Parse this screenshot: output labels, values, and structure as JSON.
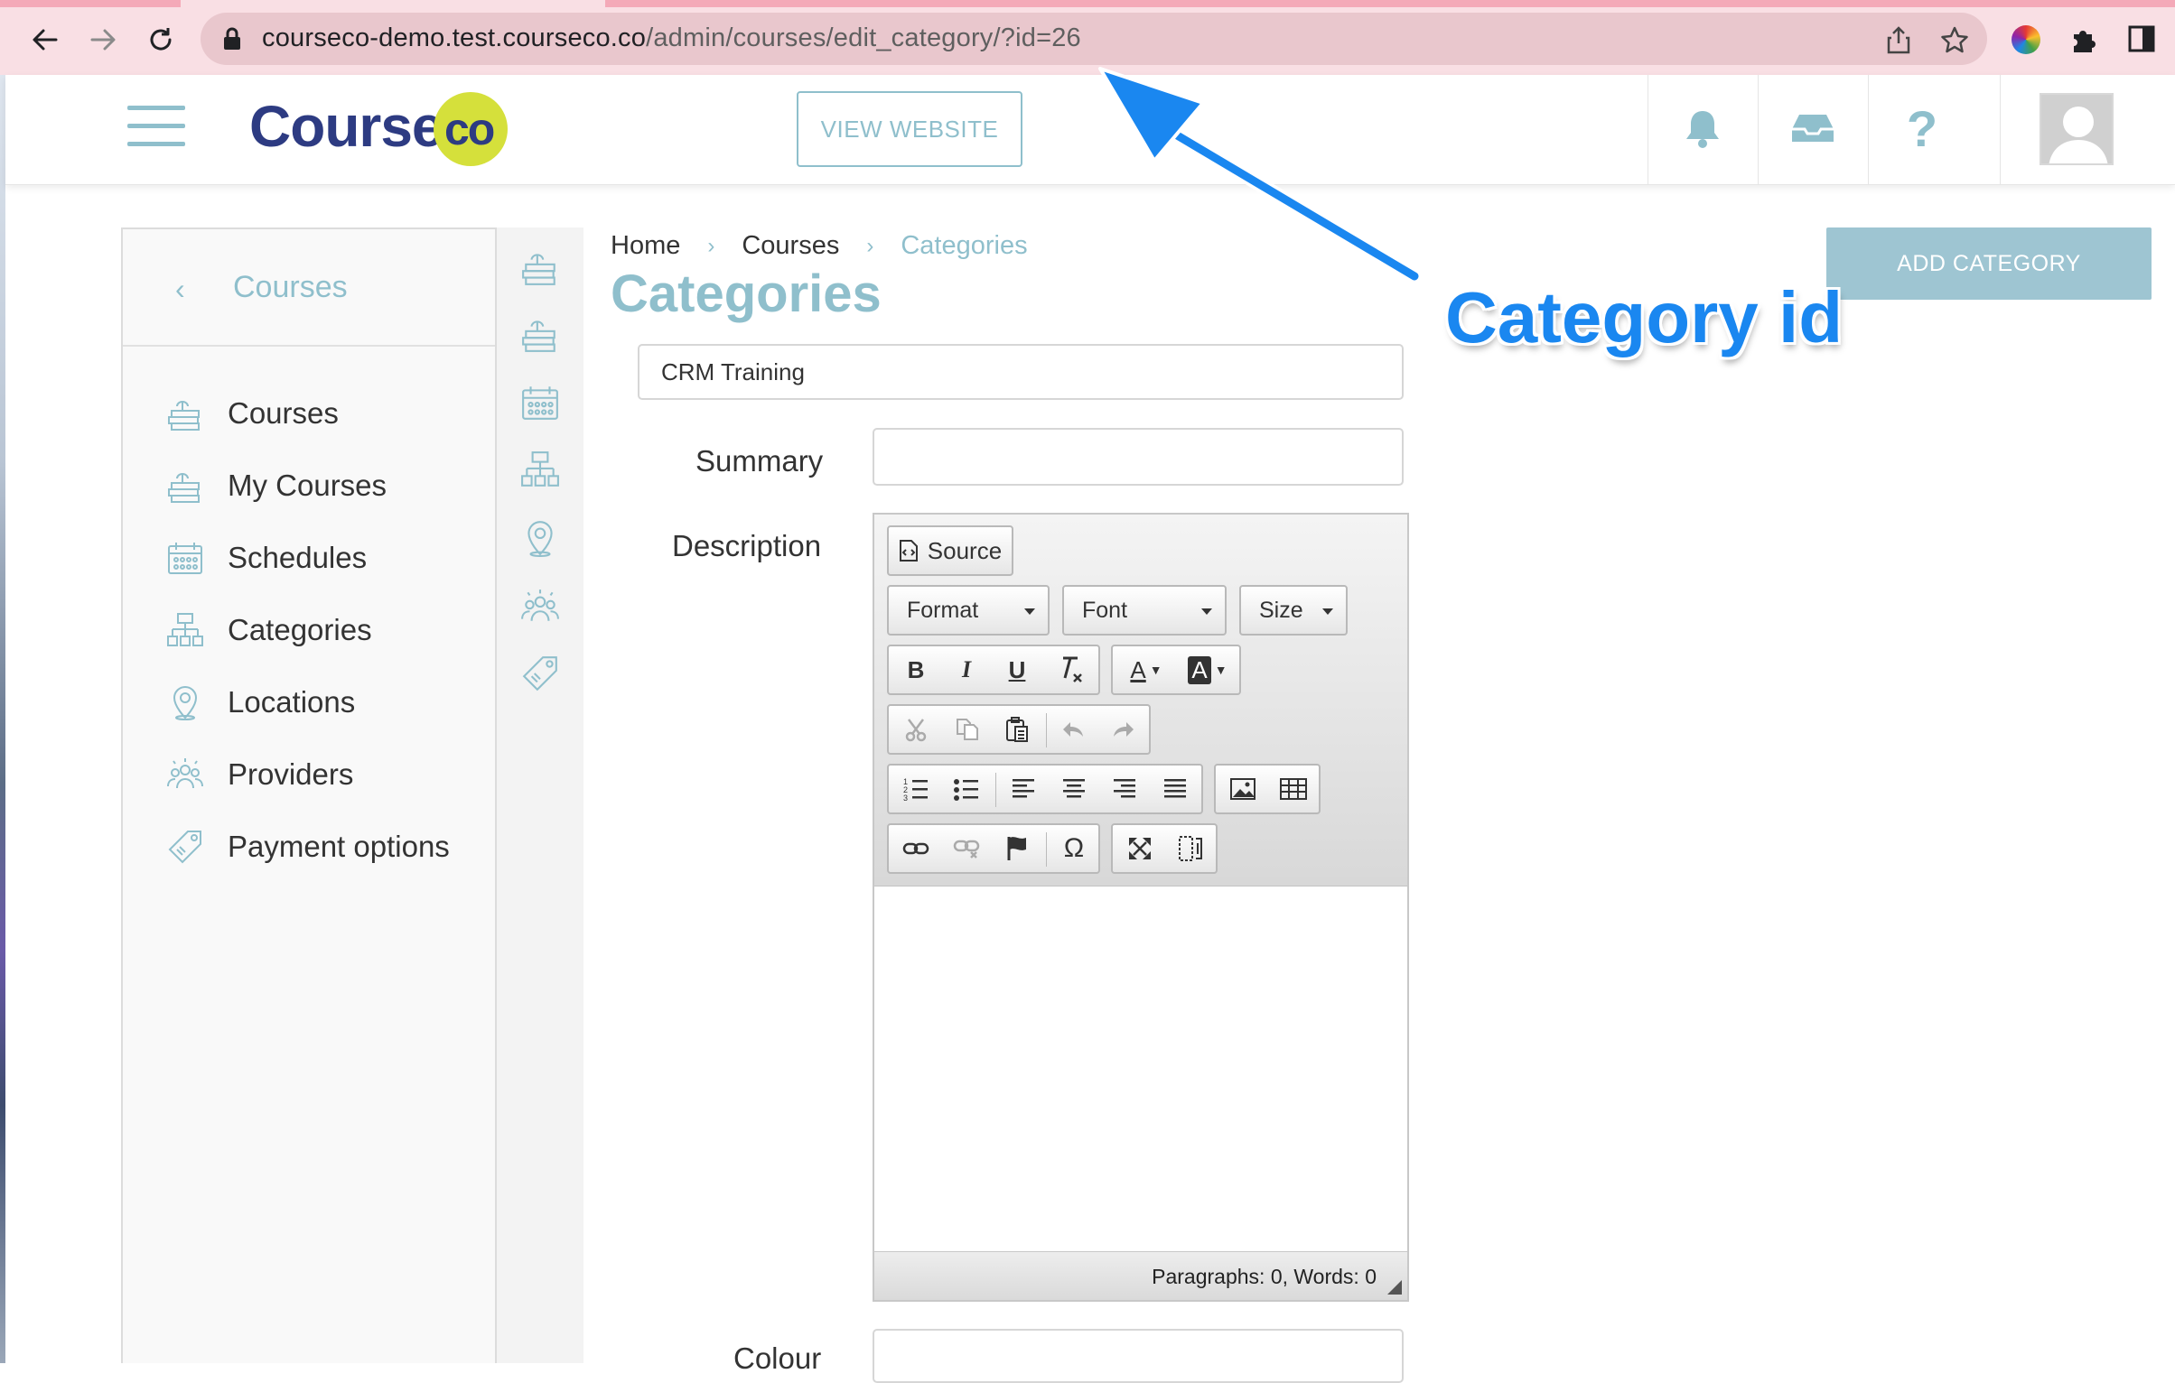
{
  "browser": {
    "url_host": "courseco-demo.test.courseco.co",
    "url_path": "/admin/courses/edit_category/?id=26"
  },
  "header": {
    "logo_text": "Course",
    "logo_badge": "co",
    "view_website_label": "VIEW WEBSITE",
    "help_glyph": "?"
  },
  "sidebar": {
    "back_glyph": "‹",
    "title": "Courses",
    "items": [
      {
        "label": "Courses",
        "icon": "course-stack-icon"
      },
      {
        "label": "My Courses",
        "icon": "course-stack-icon"
      },
      {
        "label": "Schedules",
        "icon": "calendar-icon"
      },
      {
        "label": "Categories",
        "icon": "hierarchy-icon"
      },
      {
        "label": "Locations",
        "icon": "location-pin-icon"
      },
      {
        "label": "Providers",
        "icon": "people-group-icon"
      },
      {
        "label": "Payment options",
        "icon": "price-tag-icon"
      }
    ]
  },
  "breadcrumb": {
    "items": [
      "Home",
      "Courses",
      "Categories"
    ],
    "separator": "›"
  },
  "page": {
    "title": "Categories",
    "add_button": "ADD CATEGORY"
  },
  "form": {
    "name_value": "CRM Training",
    "summary_label": "Summary",
    "summary_value": "",
    "description_label": "Description",
    "colour_label": "Colour",
    "colour_value": ""
  },
  "editor": {
    "source_label": "Source",
    "format_label": "Format",
    "font_label": "Font",
    "size_label": "Size",
    "bold_glyph": "B",
    "italic_glyph": "I",
    "underline_glyph": "U",
    "text_color_glyph": "A",
    "bg_color_glyph": "A",
    "special_char_glyph": "Ω",
    "status": "Paragraphs: 0, Words: 0"
  },
  "annotation": {
    "label": "Category id",
    "color": "#1a87f0"
  },
  "colors": {
    "accent": "#8fbfcc",
    "logo_navy": "#2d3b82",
    "logo_lime": "#d5e03b",
    "chrome_bg": "#f9dfe4"
  }
}
